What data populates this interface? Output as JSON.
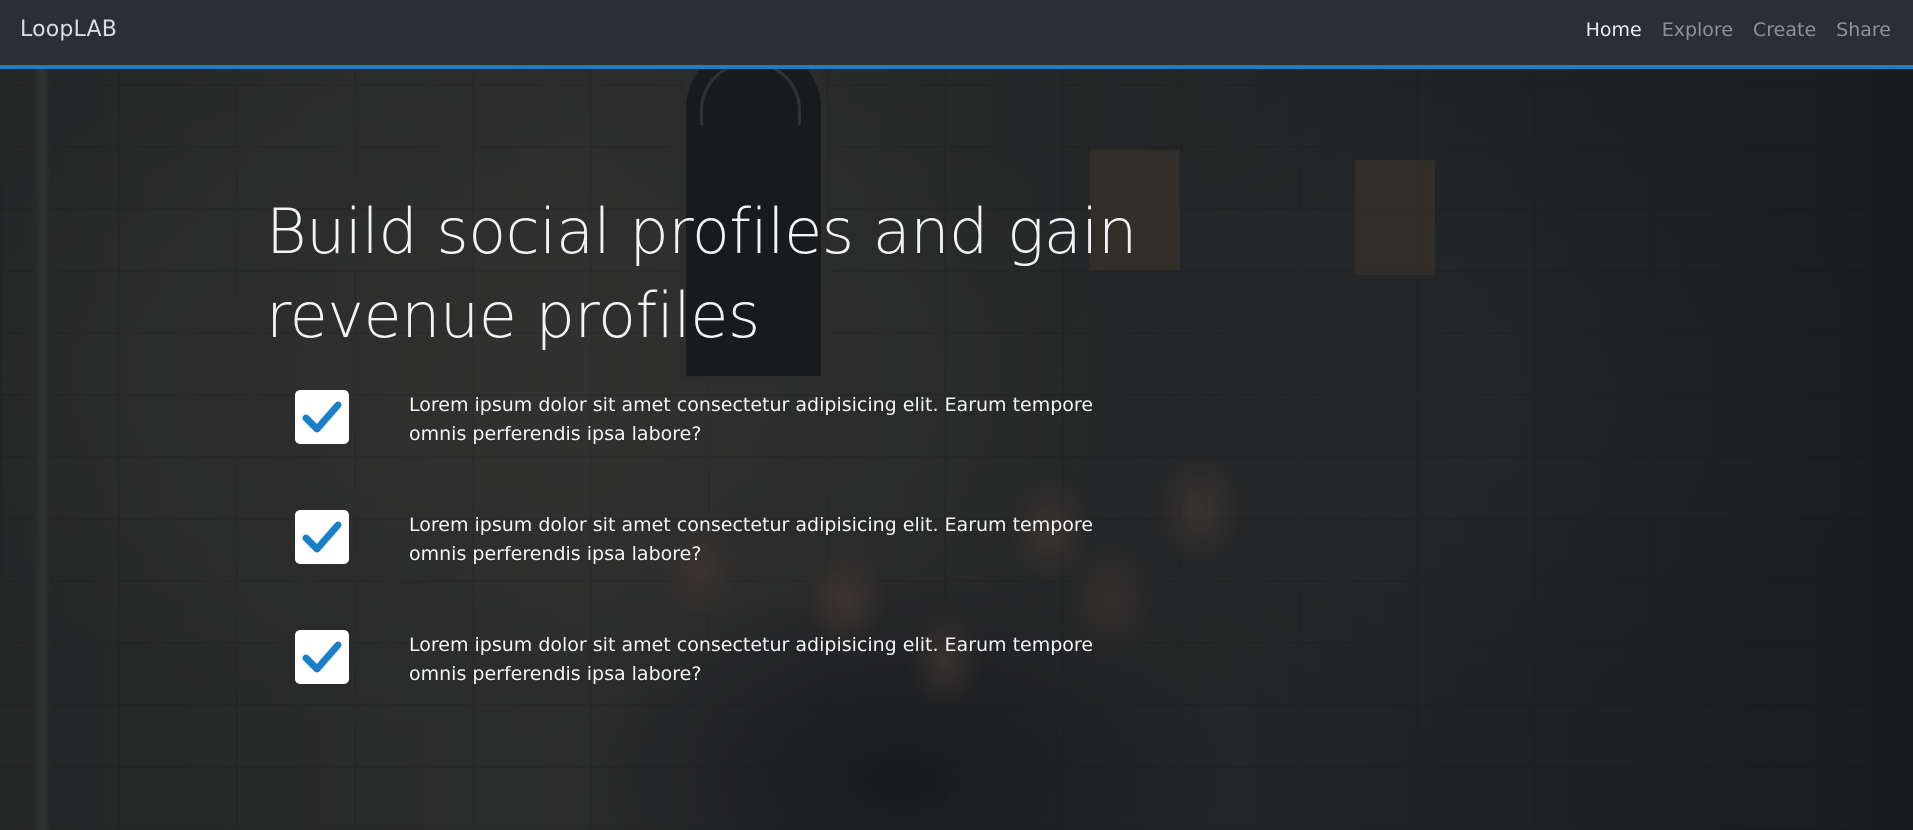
{
  "navbar": {
    "brand": "LoopLAB",
    "links": [
      {
        "label": "Home",
        "active": true
      },
      {
        "label": "Explore",
        "active": false
      },
      {
        "label": "Create",
        "active": false
      },
      {
        "label": "Share",
        "active": false
      }
    ],
    "accent_color": "#1a7fc9"
  },
  "hero": {
    "title": "Build social profiles and gain revenue profiles",
    "features": [
      {
        "icon": "checkmark-icon",
        "text": "Lorem ipsum dolor sit amet consectetur adipisicing elit. Earum tempore omnis perferendis ipsa labore?"
      },
      {
        "icon": "checkmark-icon",
        "text": "Lorem ipsum dolor sit amet consectetur adipisicing elit. Earum tempore omnis perferendis ipsa labore?"
      },
      {
        "icon": "checkmark-icon",
        "text": "Lorem ipsum dolor sit amet consectetur adipisicing elit. Earum tempore omnis perferendis ipsa labore?"
      }
    ],
    "check_color": "#1a7fc9"
  }
}
